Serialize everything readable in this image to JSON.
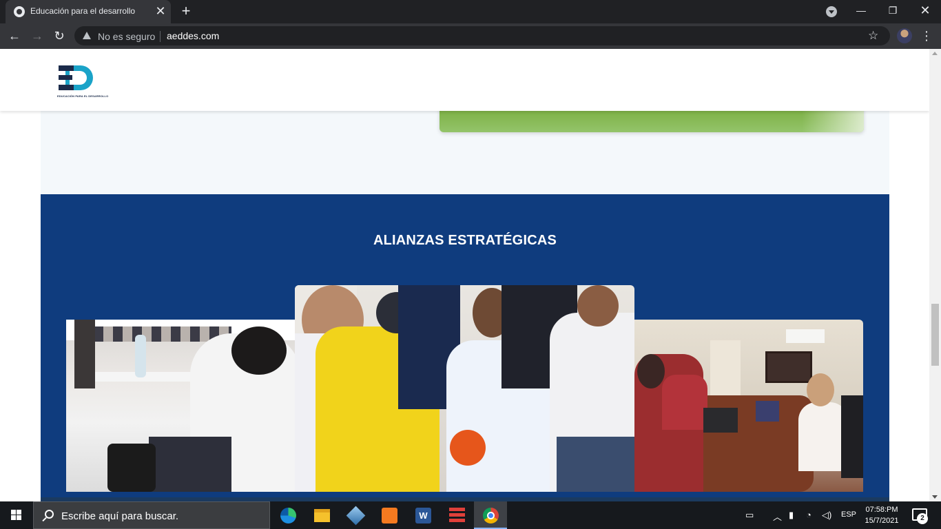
{
  "browser": {
    "tab": {
      "title": "Educación para el desarrollo",
      "favicon": "globe-icon"
    },
    "security_label": "No es seguro",
    "url": "aeddes.com"
  },
  "page": {
    "logo_text": "EDUCACIÓN PARA EL DESARROLLO",
    "section_title": "ALIANZAS ESTRATÉGICAS",
    "section_bg": "#0f3c7e",
    "photos": [
      {
        "name": "classroom-meeting-photo"
      },
      {
        "name": "football-delivery-photo"
      },
      {
        "name": "office-meeting-photo"
      }
    ]
  },
  "taskbar": {
    "search_placeholder": "Escribe aquí para buscar.",
    "apps": [
      "edge-icon",
      "file-explorer-icon",
      "virtualbox-icon",
      "xampp-icon",
      "word-icon",
      "app-icon",
      "chrome-icon"
    ],
    "language": "ESP",
    "time": "07:58:PM",
    "date": "15/7/2021",
    "notification_count": "2"
  }
}
